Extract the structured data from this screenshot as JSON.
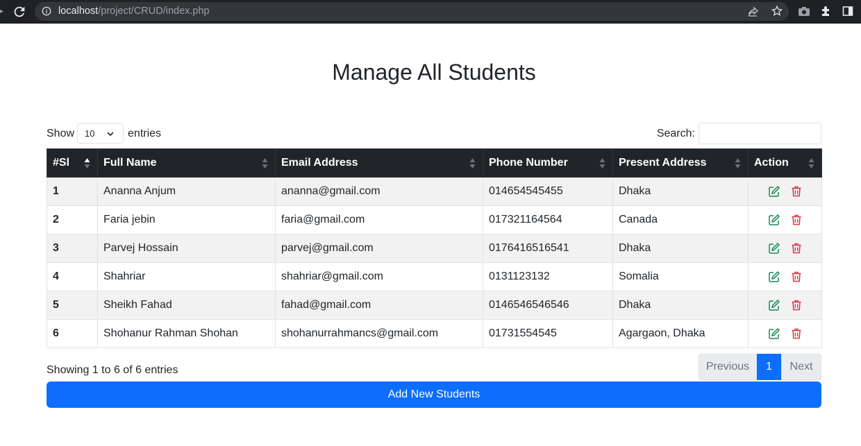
{
  "browser": {
    "url_host": "localhost",
    "url_path": "/project/CRUD/index.php"
  },
  "page": {
    "title": "Manage All Students"
  },
  "length_control": {
    "show_label": "Show",
    "selected": "10",
    "entries_label": "entries"
  },
  "search": {
    "label": "Search:",
    "value": ""
  },
  "table": {
    "columns": [
      "#Sl",
      "Full Name",
      "Email Address",
      "Phone Number",
      "Present Address",
      "Action"
    ],
    "rows": [
      {
        "sl": "1",
        "name": "Ananna Anjum",
        "email": "ananna@gmail.com",
        "phone": "014654545455",
        "address": "Dhaka"
      },
      {
        "sl": "2",
        "name": "Faria jebin",
        "email": "faria@gmail.com",
        "phone": "017321164564",
        "address": "Canada"
      },
      {
        "sl": "3",
        "name": "Parvej Hossain",
        "email": "parvej@gmail.com",
        "phone": "0176416516541",
        "address": "Dhaka"
      },
      {
        "sl": "4",
        "name": "Shahriar",
        "email": "shahriar@gmail.com",
        "phone": "0131123132",
        "address": "Somalia"
      },
      {
        "sl": "5",
        "name": "Sheikh Fahad",
        "email": "fahad@gmail.com",
        "phone": "0146546546546",
        "address": "Dhaka"
      },
      {
        "sl": "6",
        "name": "Shohanur Rahman Shohan",
        "email": "shohanurrahmancs@gmail.com",
        "phone": "01731554545",
        "address": "Agargaon, Dhaka"
      }
    ],
    "action_icons": [
      "edit-icon",
      "delete-icon"
    ]
  },
  "footer": {
    "info": "Showing 1 to 6 of 6 entries",
    "pagination": {
      "previous": "Previous",
      "current": "1",
      "next": "Next"
    },
    "add_button": "Add New Students"
  },
  "colors": {
    "header_bg": "#212529",
    "primary": "#0d6efd",
    "edit": "#198754",
    "delete": "#dc3545"
  }
}
